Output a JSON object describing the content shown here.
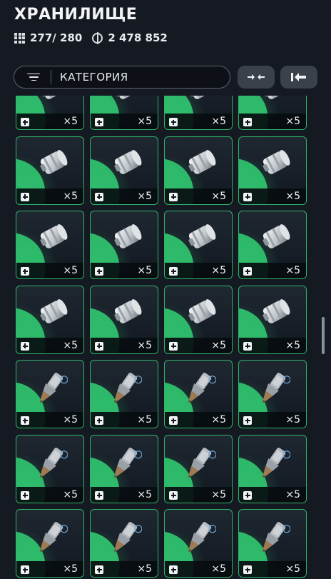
{
  "header": {
    "title": "ХРАНИЛИЩЕ"
  },
  "stats": {
    "capacity": "277/ 280",
    "currency": "2 478 852"
  },
  "filter": {
    "label": "КАТЕГОРИЯ"
  },
  "colors": {
    "accent": "#2fc16e",
    "background": "#151a22"
  },
  "grid": {
    "rows": [
      {
        "item": "canister",
        "cells": [
          {
            "qty": "×5"
          },
          {
            "qty": "×5"
          },
          {
            "qty": "×5"
          },
          {
            "qty": "×5"
          }
        ]
      },
      {
        "item": "canister",
        "cells": [
          {
            "qty": "×5"
          },
          {
            "qty": "×5"
          },
          {
            "qty": "×5"
          },
          {
            "qty": "×5"
          }
        ]
      },
      {
        "item": "canister",
        "cells": [
          {
            "qty": "×5"
          },
          {
            "qty": "×5"
          },
          {
            "qty": "×5"
          },
          {
            "qty": "×5"
          }
        ]
      },
      {
        "item": "canister",
        "cells": [
          {
            "qty": "×5"
          },
          {
            "qty": "×5"
          },
          {
            "qty": "×5"
          },
          {
            "qty": "×5"
          }
        ]
      },
      {
        "item": "injector",
        "cells": [
          {
            "qty": "×5"
          },
          {
            "qty": "×5"
          },
          {
            "qty": "×5"
          },
          {
            "qty": "×5"
          }
        ]
      },
      {
        "item": "injector",
        "cells": [
          {
            "qty": "×5"
          },
          {
            "qty": "×5"
          },
          {
            "qty": "×5"
          },
          {
            "qty": "×5"
          }
        ]
      },
      {
        "item": "injector",
        "cells": [
          {
            "qty": "×5"
          },
          {
            "qty": "×5"
          },
          {
            "qty": "×5"
          },
          {
            "qty": "×5"
          }
        ]
      }
    ]
  }
}
